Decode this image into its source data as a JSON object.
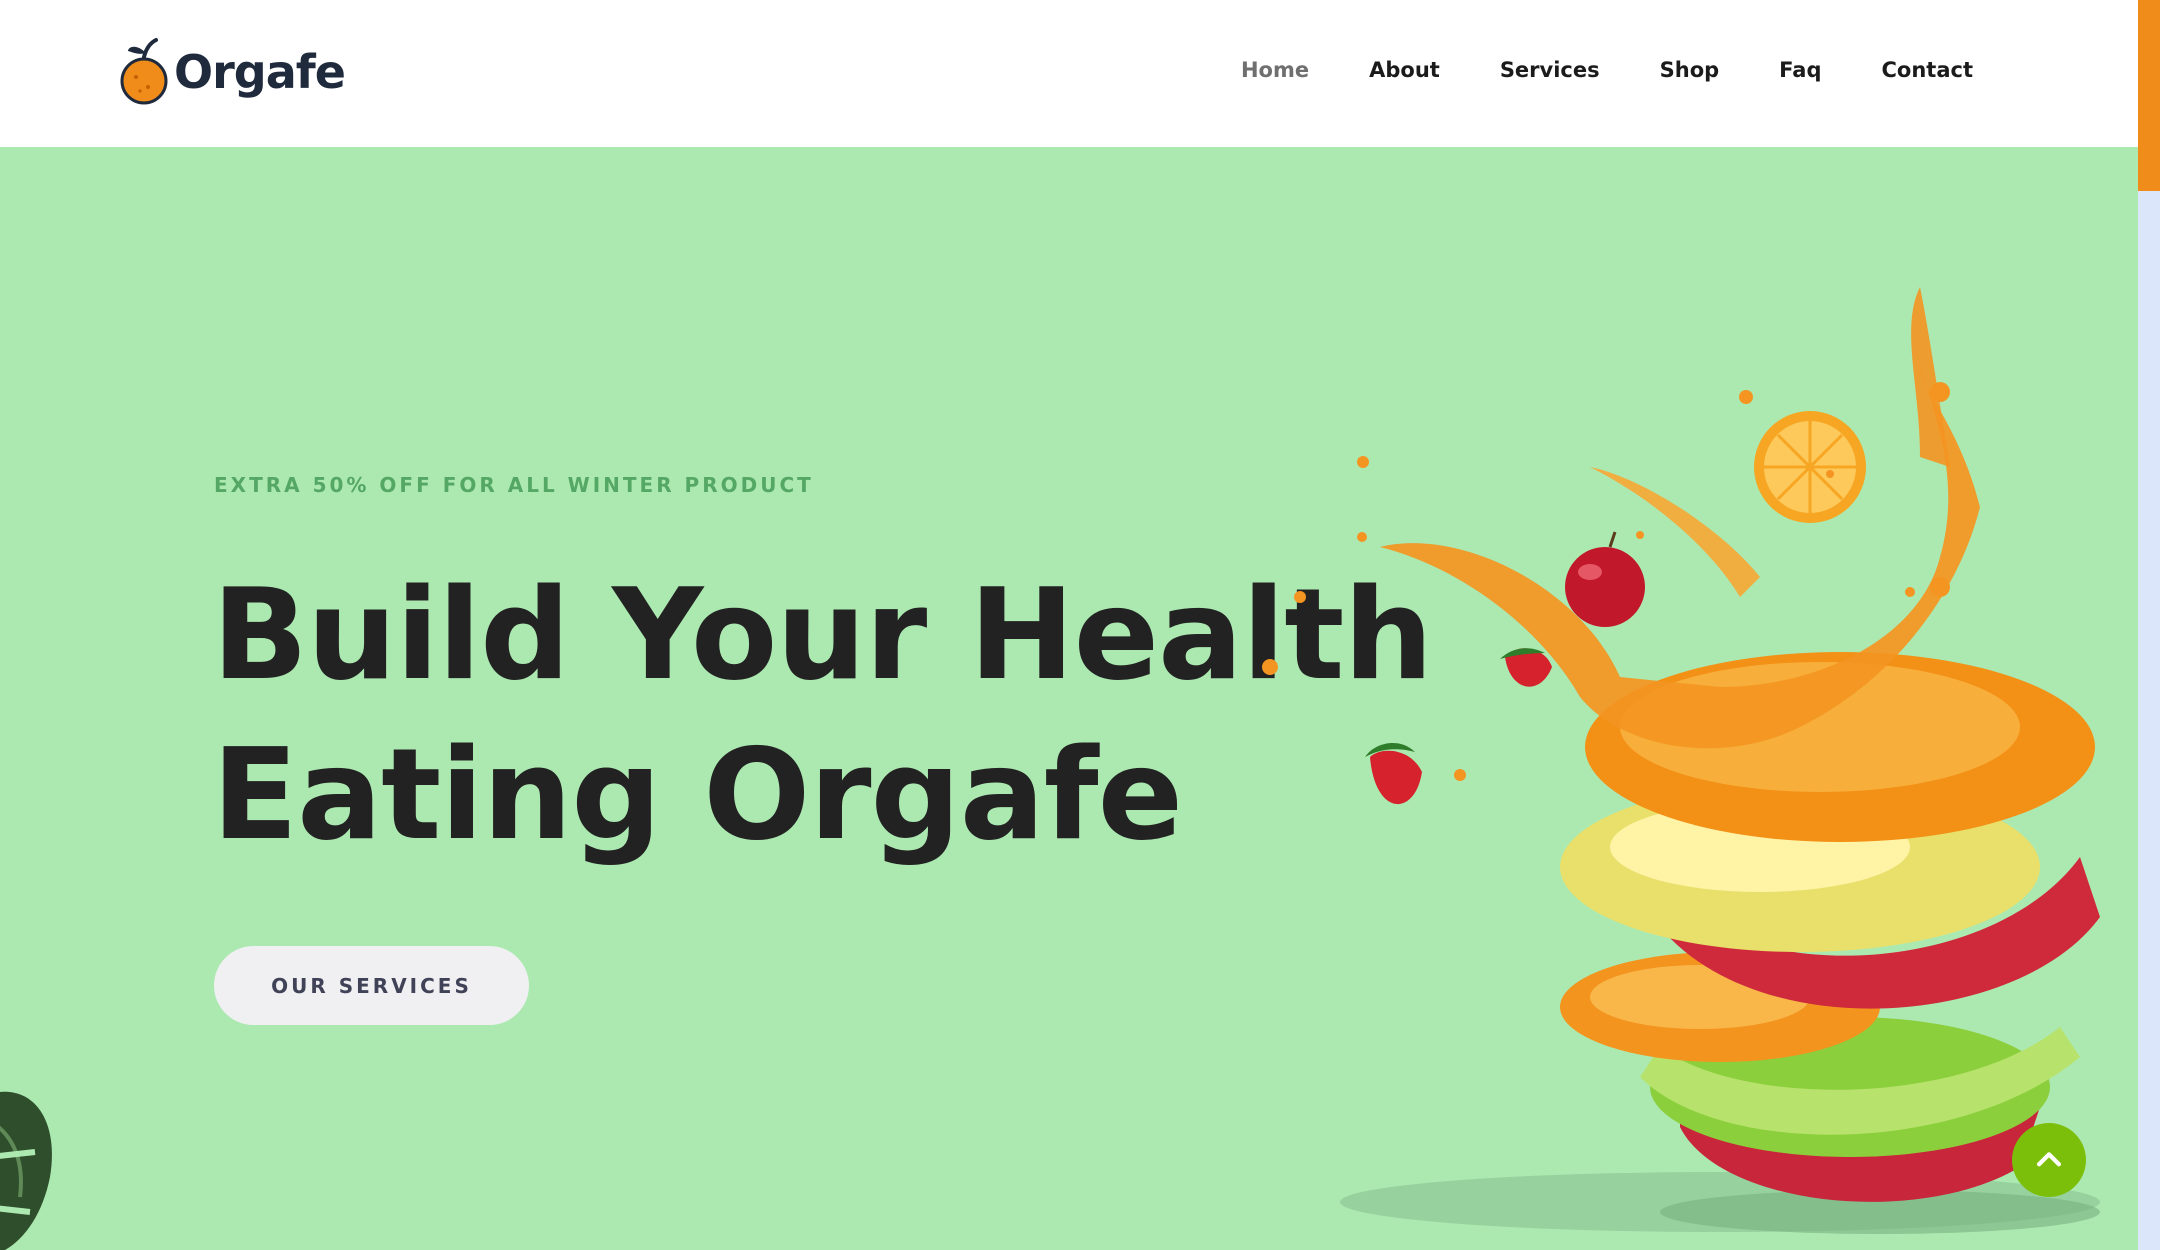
{
  "brand": {
    "name": "Orgafe",
    "logo_icon": "orange-fruit-icon"
  },
  "nav": {
    "items": [
      {
        "label": "Home",
        "active": true
      },
      {
        "label": "About",
        "active": false
      },
      {
        "label": "Services",
        "active": false
      },
      {
        "label": "Shop",
        "active": false
      },
      {
        "label": "Faq",
        "active": false
      },
      {
        "label": "Contact",
        "active": false
      }
    ]
  },
  "hero": {
    "promo": "EXTRA 50% OFF FOR ALL WINTER PRODUCT",
    "headline_line1": "Build Your Health",
    "headline_line2": "Eating Orgafe",
    "cta_label": "OUR SERVICES",
    "image": "stacked-fruit-slices-juice-splash",
    "decoration": "monstera-leaf"
  },
  "back_to_top": {
    "icon": "chevron-up-icon"
  },
  "colors": {
    "hero_bg": "#ace9b1",
    "promo_text": "#55a765",
    "headline_text": "#222222",
    "accent_orange": "#f08c1a",
    "back_to_top_bg": "#7cbf0a",
    "scrollbar_track": "#dbe6fb"
  }
}
